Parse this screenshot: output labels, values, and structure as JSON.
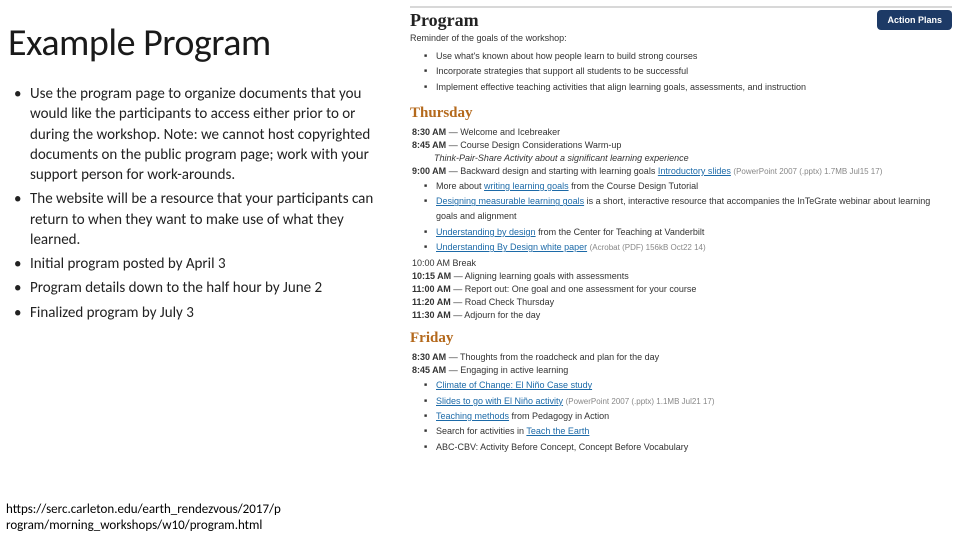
{
  "left": {
    "title": "Example Program",
    "bullets": [
      "Use the program page to organize documents that you would like the participants to access either prior to or during the workshop. Note: we cannot host copyrighted documents on the public program page; work with your support person for work-arounds.",
      "The website will be a resource that your participants can return to when they want to make use of what they learned.",
      "Initial program posted by April 3",
      "Program details down to the half hour by June 2",
      "Finalized program by July 3"
    ],
    "url_line1": "https://serc.carleton.edu/earth_rendezvous/2017/p",
    "url_line2": "rogram/morning_workshops/w10/program.html"
  },
  "right": {
    "program_heading": "Program",
    "action_button": "Action Plans",
    "reminder": "Reminder of the goals of the workshop:",
    "goals": [
      "Use what's known about how people learn to build strong courses",
      "Incorporate strategies that support all students to be successful",
      "Implement effective teaching activities that align learning goals, assessments, and instruction"
    ],
    "thursday": {
      "heading": "Thursday",
      "line1_time": "8:30 AM",
      "line1_text": "Welcome and Icebreaker",
      "line2_time": "8:45 AM",
      "line2_text": "Course Design Considerations Warm-up",
      "italic_note": "Think-Pair-Share Activity about a significant learning experience",
      "line3_time": "9:00 AM",
      "line3_text_a": "Backward design and starting with learning goals",
      "line3_link": "Introductory slides",
      "line3_meta": "(PowerPoint 2007 (.pptx) 1.7MB Jul15 17)",
      "sub_bullets": [
        {
          "pre": "More about ",
          "link": "writing learning goals",
          "post": " from the Course Design Tutorial"
        },
        {
          "pre": "",
          "link": "Designing measurable learning goals",
          "post": " is a short, interactive resource that accompanies the InTeGrate webinar about learning goals and alignment"
        },
        {
          "pre": "",
          "link": "Understanding by design",
          "post": " from the Center for Teaching at Vanderbilt"
        },
        {
          "pre": "",
          "link": "Understanding By Design white paper",
          "post": "",
          "meta": "(Acrobat (PDF) 156kB Oct22 14)"
        }
      ],
      "line4": "10:00 AM Break",
      "line5_time": "10:15 AM",
      "line5_text": "Aligning learning goals with assessments",
      "line6_time": "11:00 AM",
      "line6_text": "Report out: One goal and one assessment for your course",
      "line7_time": "11:20 AM",
      "line7_text": "Road Check Thursday",
      "line8_time": "11:30 AM",
      "line8_text": "Adjourn for the day"
    },
    "friday": {
      "heading": "Friday",
      "line1_time": "8:30 AM",
      "line1_text": "Thoughts from the roadcheck and plan for the day",
      "line2_time": "8:45 AM",
      "line2_text": "Engaging in active learning",
      "sub_bullets": [
        {
          "pre": "",
          "link": "Climate of Change: El Niño Case study",
          "post": ""
        },
        {
          "pre": "",
          "link": "Slides to go with El Niño activity",
          "post": "",
          "meta": "(PowerPoint 2007 (.pptx) 1.1MB Jul21 17)"
        },
        {
          "pre": "",
          "link": "Teaching methods",
          "post": " from Pedagogy in Action"
        },
        {
          "pre": "Search for activities in ",
          "link": "Teach the Earth",
          "post": ""
        },
        {
          "pre": "ABC-CBV: Activity Before Concept, Concept Before Vocabulary",
          "link": "",
          "post": ""
        }
      ]
    }
  }
}
